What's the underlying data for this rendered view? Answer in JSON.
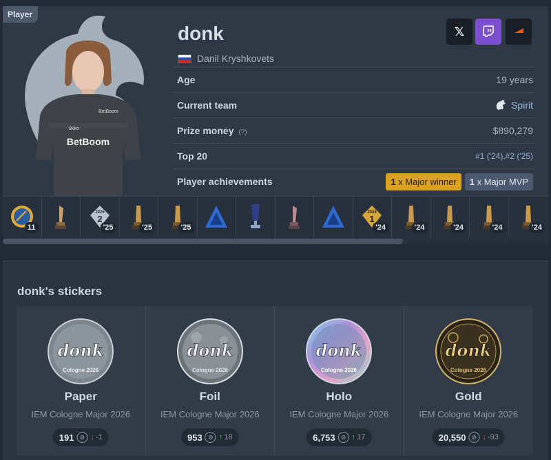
{
  "card": {
    "tag": "Player",
    "nickname": "donk",
    "full_name": "Danil Kryshkovets",
    "socials": [
      {
        "name": "x",
        "label": "𝕏"
      },
      {
        "name": "twitch"
      },
      {
        "name": "faceit"
      }
    ],
    "info": [
      {
        "label": "Age",
        "value": "19 years"
      },
      {
        "label": "Current team",
        "value": "Spirit"
      },
      {
        "label": "Prize money",
        "hint": "(?)",
        "value": "$890,279"
      },
      {
        "label": "Top 20",
        "value": "#1 ('24),#2 ('25)"
      },
      {
        "label": "Player achievements"
      }
    ],
    "badges": {
      "winner_count": "1",
      "winner_text": " x Major winner",
      "mvp_count": "1",
      "mvp_text": " x Major MVP"
    },
    "trophies": [
      {
        "icon": "medal-icon",
        "label": "11"
      },
      {
        "icon": "trophy-icon",
        "label": ""
      },
      {
        "icon": "rank-2-2025-icon",
        "label": "'25"
      },
      {
        "icon": "trophy-icon",
        "label": "'25"
      },
      {
        "icon": "trophy-icon",
        "label": "'25"
      },
      {
        "icon": "blast-icon",
        "label": ""
      },
      {
        "icon": "cup-icon",
        "label": ""
      },
      {
        "icon": "trophy-icon",
        "label": ""
      },
      {
        "icon": "blast-icon",
        "label": ""
      },
      {
        "icon": "rank-1-2024-icon",
        "label": "'24"
      },
      {
        "icon": "trophy-icon",
        "label": "'24"
      },
      {
        "icon": "trophy-icon",
        "label": "'24"
      },
      {
        "icon": "trophy-icon",
        "label": "'24"
      },
      {
        "icon": "trophy-icon",
        "label": "'24"
      }
    ],
    "rank2_year": "2025",
    "rank2_num": "2",
    "rank1_year": "2024",
    "rank1_num": "1"
  },
  "stickers": {
    "title": "donk's stickers",
    "items": [
      {
        "name": "Paper",
        "event": "IEM Cologne Major 2026",
        "count": "191",
        "arrow": "↓",
        "delta": "-1",
        "trend": "down"
      },
      {
        "name": "Foil",
        "event": "IEM Cologne Major 2026",
        "count": "953",
        "arrow": "↑",
        "delta": "18",
        "trend": "up"
      },
      {
        "name": "Holo",
        "event": "IEM Cologne Major 2026",
        "count": "6,753",
        "arrow": "↑",
        "delta": "17",
        "trend": "up"
      },
      {
        "name": "Gold",
        "event": "IEM Cologne Major 2026",
        "count": "20,550",
        "arrow": "↓",
        "delta": "-93",
        "trend": "down"
      }
    ],
    "sticker_text": "donk",
    "sticker_subtext": "Cologne 2026"
  },
  "colors": {
    "background": "#232b36",
    "card": "#2f3946",
    "winner_badge": "#d9a226",
    "twitch": "#7c4fd1",
    "faceit_orange": "#ff5500",
    "trend_up": "#4fbf5b",
    "trend_down": "#d0534b"
  }
}
